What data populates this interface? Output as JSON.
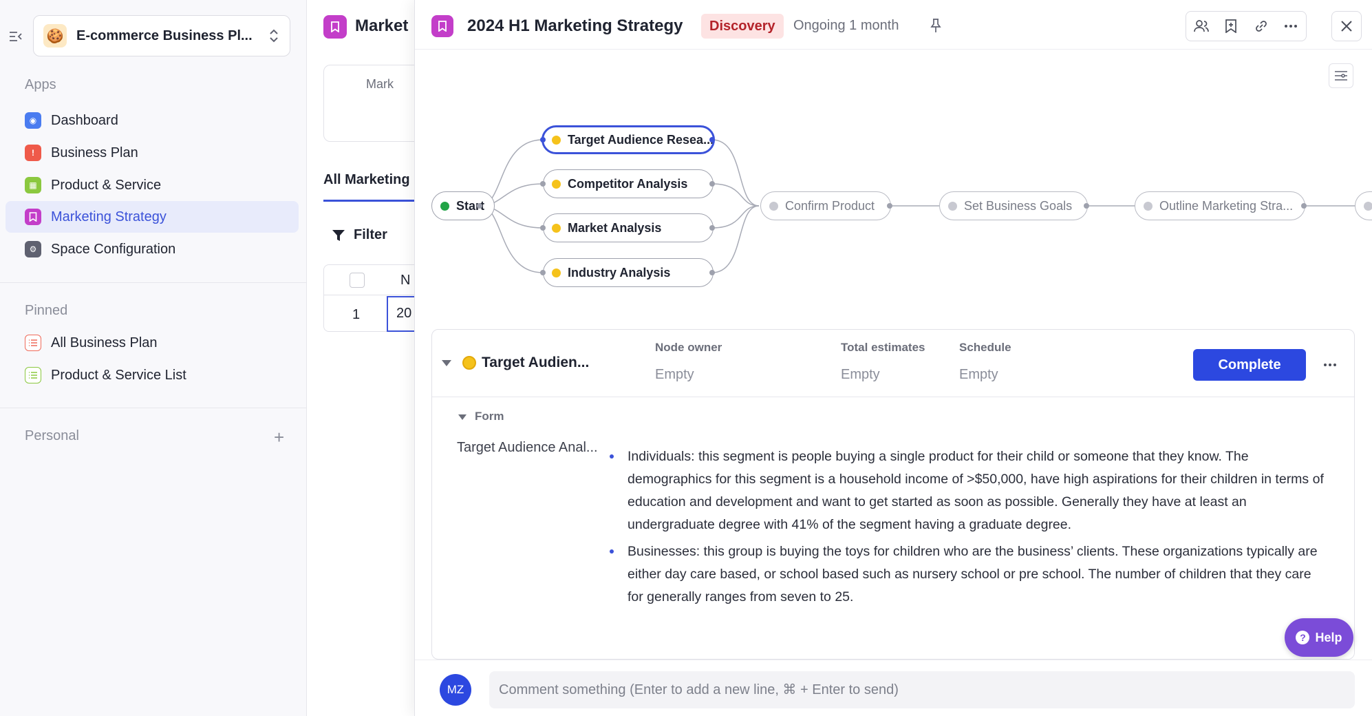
{
  "sidebar": {
    "space": {
      "emoji": "🍪",
      "name": "E-commerce Business Pl..."
    },
    "apps_label": "Apps",
    "apps": [
      {
        "label": "Dashboard",
        "icon": "dashboard-icon",
        "color": "#4a7cf0"
      },
      {
        "label": "Business Plan",
        "icon": "business-plan-icon",
        "color": "#ef5a4a"
      },
      {
        "label": "Product & Service",
        "icon": "grid-icon",
        "color": "#8bc83f"
      },
      {
        "label": "Marketing Strategy",
        "icon": "bookmark-icon",
        "color": "#c33ec9",
        "active": true
      },
      {
        "label": "Space Configuration",
        "icon": "gear-icon",
        "color": "#5f6170"
      }
    ],
    "pinned_label": "Pinned",
    "pinned": [
      {
        "label": "All Business Plan",
        "icon": "list-icon",
        "color": "#ef6a5a"
      },
      {
        "label": "Product & Service List",
        "icon": "list-icon",
        "color": "#8bc83f"
      }
    ],
    "personal_label": "Personal"
  },
  "middle": {
    "title": "Market",
    "card_text": "Mark",
    "tab": "All Marketing",
    "filter": "Filter",
    "col_header": "N",
    "row_num": "1",
    "cell_value": "20"
  },
  "drawer": {
    "title": "2024 H1 Marketing Strategy",
    "stage": "Discovery",
    "status": "Ongoing 1 month",
    "flow": {
      "start": "Start",
      "branches": [
        "Target Audience Resea...",
        "Competitor Analysis",
        "Market Analysis",
        "Industry Analysis"
      ],
      "next": [
        "Confirm Product",
        "Set Business Goals",
        "Outline Marketing Stra..."
      ]
    },
    "panel": {
      "node_name": "Target Audien...",
      "node_owner_label": "Node owner",
      "node_owner_value": "Empty",
      "estimates_label": "Total estimates",
      "estimates_value": "Empty",
      "schedule_label": "Schedule",
      "schedule_value": "Empty",
      "complete_label": "Complete",
      "form_label": "Form",
      "field_label": "Target Audience Anal...",
      "bullets": [
        "Individuals: this segment is people buying a single product for their child or someone that they know. The demographics for this segment is a household income of >$50,000, have high aspirations for their children in terms of education and development and want to get started as soon as possible. Generally they have at least an undergraduate degree with 41% of the segment having a graduate degree.",
        "Businesses: this group is buying the toys for children who are the business’ clients. These organizations typically are either day care based, or school based such as nursery school or pre school. The number of children that they care for generally ranges from seven to 25."
      ]
    },
    "help_label": "Help",
    "comment": {
      "avatar": "MZ",
      "placeholder": "Comment something (Enter to add a new line, ⌘ + Enter to send)"
    }
  }
}
